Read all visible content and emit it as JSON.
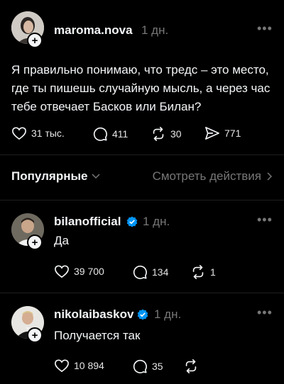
{
  "colors": {
    "background": "#000000",
    "text": "#f3f5f7",
    "muted": "#777777",
    "verified": "#0095f6"
  },
  "main_post": {
    "username": "maroma.nova",
    "time": "1 дн.",
    "more_icon": "more-dots-icon",
    "text": "Я правильно понимаю, что тредс – это место, где ты пишешь случайную мысль, а через час тебе отвечает Басков или Билан?",
    "likes": "31 тыс.",
    "comments": "411",
    "reposts": "30",
    "shares": "771"
  },
  "replies_header": {
    "sort_label": "Популярные",
    "activity_label": "Смотреть действия"
  },
  "replies": [
    {
      "username": "bilanofficial",
      "time": "1 дн.",
      "text": "Да",
      "likes": "39 700",
      "comments": "134",
      "reposts": "1"
    },
    {
      "username": "nikolaibaskov",
      "time": "1 дн.",
      "text": "Получается так",
      "likes": "10 894",
      "comments": "35",
      "reposts": ""
    }
  ]
}
